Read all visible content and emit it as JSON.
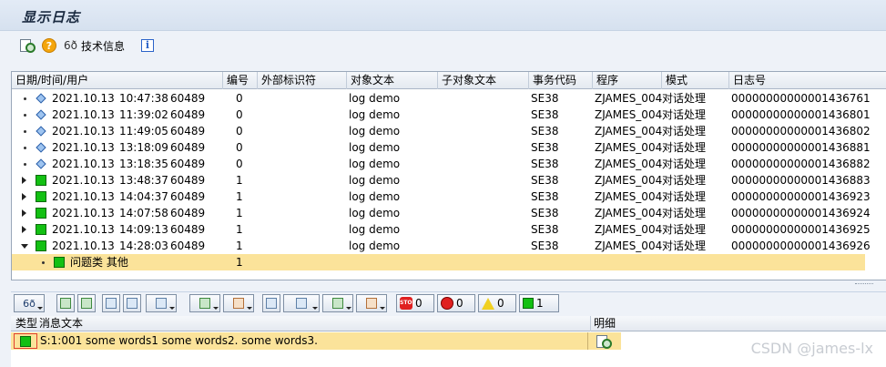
{
  "window": {
    "title": "显示日志"
  },
  "app_toolbar": {
    "tech_info_label": "技术信息",
    "help_glyph": "?",
    "info_glyph": "i",
    "glasses_glyph": "6ð"
  },
  "log_grid": {
    "headers": [
      "日期/时间/用户",
      "编号",
      "外部标识符",
      "对象文本",
      "子对象文本",
      "事务代码",
      "程序",
      "模式",
      "日志号"
    ],
    "rows": [
      {
        "expander": "bullet",
        "icon": "diamond-icon",
        "date": "2021.10.13",
        "time": "10:47:38",
        "user": "60489",
        "num": "0",
        "ext": "",
        "obj": "log demo",
        "subobj": "",
        "tcode": "SE38",
        "prog": "ZJAMES_004",
        "mode": "对话处理",
        "logno": "00000000000001436761"
      },
      {
        "expander": "bullet",
        "icon": "diamond-icon",
        "date": "2021.10.13",
        "time": "11:39:02",
        "user": "60489",
        "num": "0",
        "ext": "",
        "obj": "log demo",
        "subobj": "",
        "tcode": "SE38",
        "prog": "ZJAMES_004",
        "mode": "对话处理",
        "logno": "00000000000001436801"
      },
      {
        "expander": "bullet",
        "icon": "diamond-icon",
        "date": "2021.10.13",
        "time": "11:49:05",
        "user": "60489",
        "num": "0",
        "ext": "",
        "obj": "log demo",
        "subobj": "",
        "tcode": "SE38",
        "prog": "ZJAMES_004",
        "mode": "对话处理",
        "logno": "00000000000001436802"
      },
      {
        "expander": "bullet",
        "icon": "diamond-icon",
        "date": "2021.10.13",
        "time": "13:18:09",
        "user": "60489",
        "num": "0",
        "ext": "",
        "obj": "log demo",
        "subobj": "",
        "tcode": "SE38",
        "prog": "ZJAMES_004",
        "mode": "对话处理",
        "logno": "00000000000001436881"
      },
      {
        "expander": "bullet",
        "icon": "diamond-icon",
        "date": "2021.10.13",
        "time": "13:18:35",
        "user": "60489",
        "num": "0",
        "ext": "",
        "obj": "log demo",
        "subobj": "",
        "tcode": "SE38",
        "prog": "ZJAMES_004",
        "mode": "对话处理",
        "logno": "00000000000001436882"
      },
      {
        "expander": "closed",
        "icon": "green-icon",
        "date": "2021.10.13",
        "time": "13:48:37",
        "user": "60489",
        "num": "1",
        "ext": "",
        "obj": "log demo",
        "subobj": "",
        "tcode": "SE38",
        "prog": "ZJAMES_004",
        "mode": "对话处理",
        "logno": "00000000000001436883"
      },
      {
        "expander": "closed",
        "icon": "green-icon",
        "date": "2021.10.13",
        "time": "14:04:37",
        "user": "60489",
        "num": "1",
        "ext": "",
        "obj": "log demo",
        "subobj": "",
        "tcode": "SE38",
        "prog": "ZJAMES_004",
        "mode": "对话处理",
        "logno": "00000000000001436923"
      },
      {
        "expander": "closed",
        "icon": "green-icon",
        "date": "2021.10.13",
        "time": "14:07:58",
        "user": "60489",
        "num": "1",
        "ext": "",
        "obj": "log demo",
        "subobj": "",
        "tcode": "SE38",
        "prog": "ZJAMES_004",
        "mode": "对话处理",
        "logno": "00000000000001436924"
      },
      {
        "expander": "closed",
        "icon": "green-icon",
        "date": "2021.10.13",
        "time": "14:09:13",
        "user": "60489",
        "num": "1",
        "ext": "",
        "obj": "log demo",
        "subobj": "",
        "tcode": "SE38",
        "prog": "ZJAMES_004",
        "mode": "对话处理",
        "logno": "00000000000001436925"
      },
      {
        "expander": "open",
        "icon": "green-icon",
        "date": "2021.10.13",
        "time": "14:28:03",
        "user": "60489",
        "num": "1",
        "ext": "",
        "obj": "log demo",
        "subobj": "",
        "tcode": "SE38",
        "prog": "ZJAMES_004",
        "mode": "对话处理",
        "logno": "00000000000001436926"
      }
    ],
    "sub_row": {
      "label": "问题类 其他",
      "num": "1"
    }
  },
  "message_toolbar": {
    "counts": {
      "stop": "0",
      "error": "0",
      "warning": "0",
      "success": "1"
    },
    "stop_glyph": "STOP"
  },
  "message_grid": {
    "headers": {
      "type": "类型",
      "text": "消息文本",
      "detail": "明细"
    },
    "rows": [
      {
        "type_icon": "success",
        "text": "S:1:001 some words1 some words2. some words3."
      }
    ]
  },
  "watermark": "CSDN @james-lx",
  "colors": {
    "selected_row": "#fbe39a",
    "success_green": "#13c013",
    "error_red": "#e02020",
    "warning_yellow": "#f0d020"
  }
}
